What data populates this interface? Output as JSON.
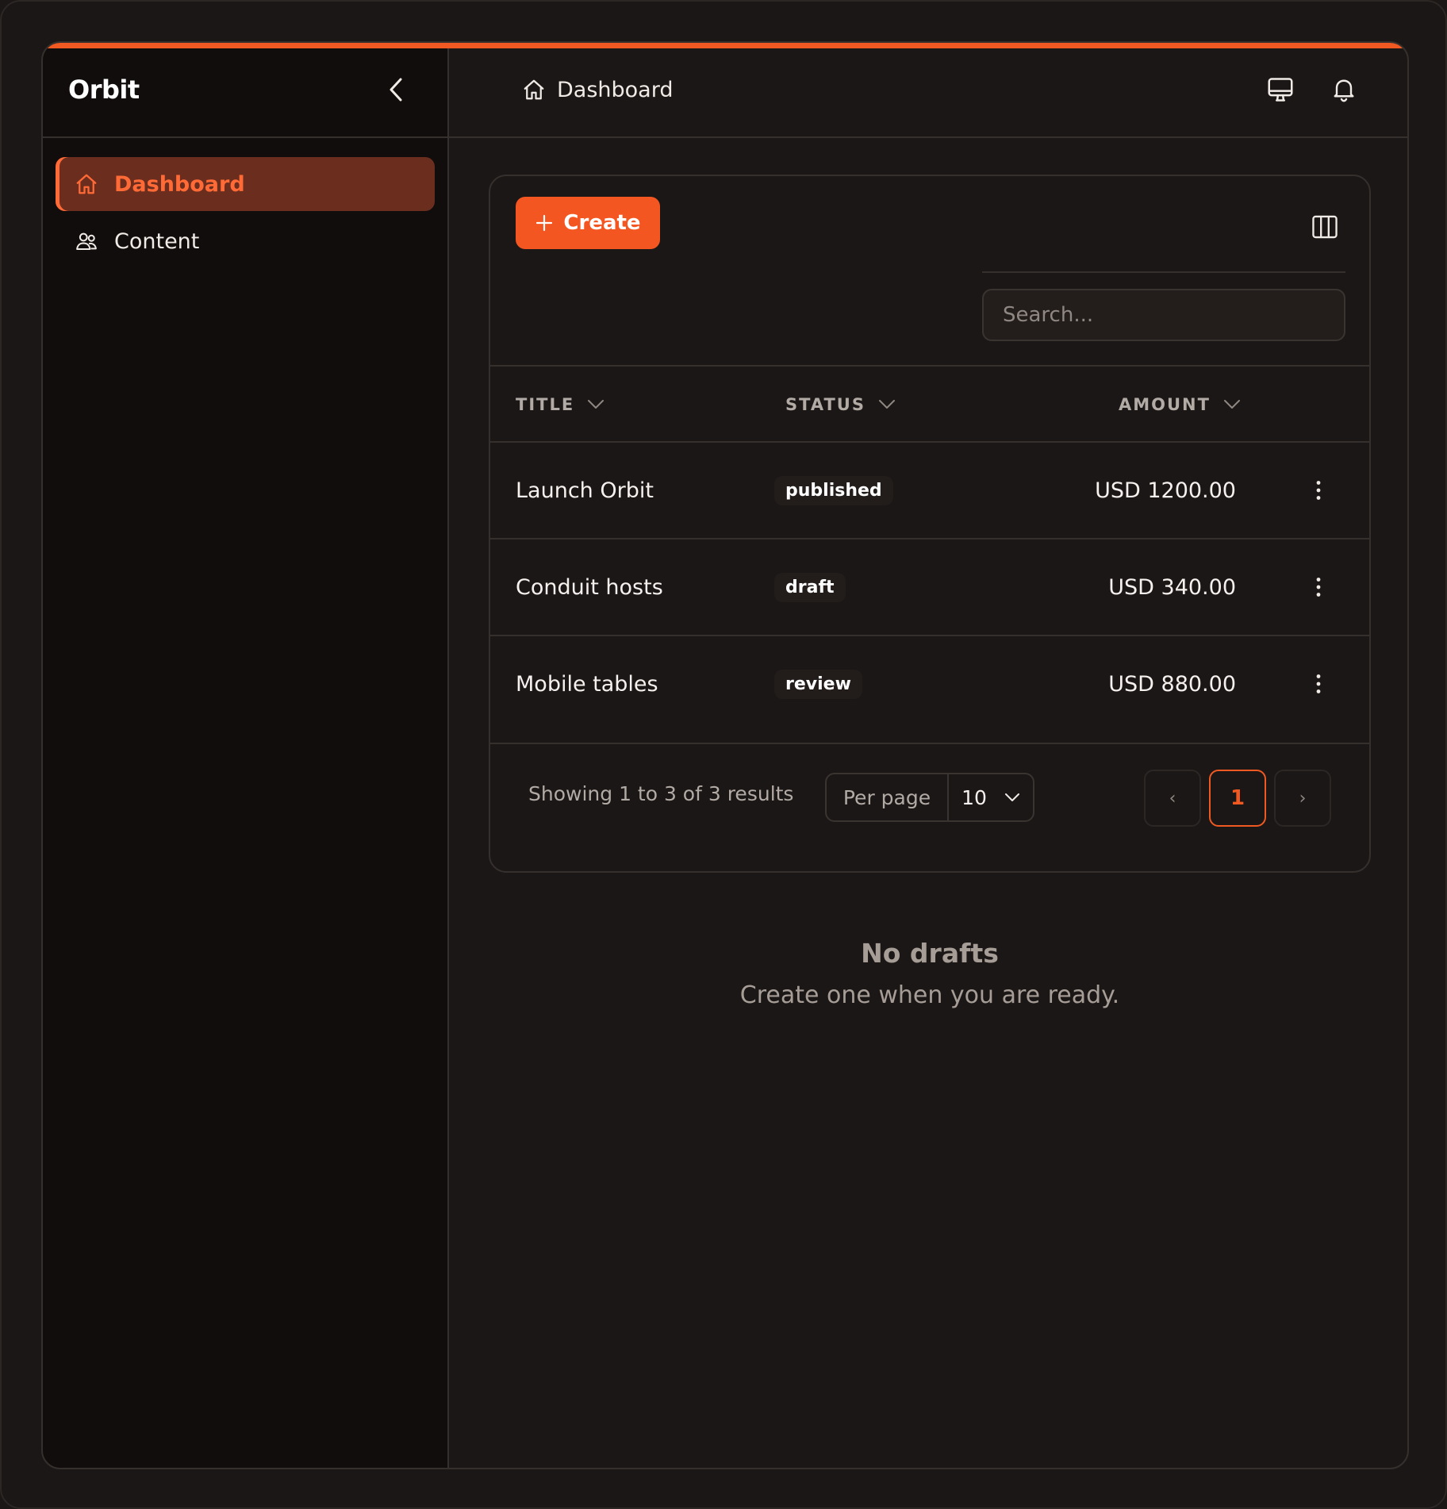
{
  "app": {
    "brand": "Orbit"
  },
  "sidebar": {
    "items": [
      {
        "label": "Dashboard",
        "icon": "home-icon",
        "active": true
      },
      {
        "label": "Content",
        "icon": "users-icon",
        "active": false
      }
    ]
  },
  "header": {
    "breadcrumb": "Dashboard"
  },
  "toolbar": {
    "create_label": "Create",
    "search_placeholder": "Search..."
  },
  "table": {
    "columns": [
      "TITLE",
      "STATUS",
      "AMOUNT"
    ],
    "rows": [
      {
        "title": "Launch Orbit",
        "status": "published",
        "amount": "USD 1200.00"
      },
      {
        "title": "Conduit hosts",
        "status": "draft",
        "amount": "USD 340.00"
      },
      {
        "title": "Mobile tables",
        "status": "review",
        "amount": "USD 880.00"
      }
    ]
  },
  "footer": {
    "showing": "Showing 1 to 3 of 3 results",
    "per_page_label": "Per page",
    "per_page_value": "10",
    "prev": "‹",
    "current_page": "1",
    "next": "›"
  },
  "empty": {
    "title": "No drafts",
    "subtitle": "Create one when you are ready."
  },
  "colors": {
    "accent": "#f05a22",
    "active_bg": "#6b2e1e",
    "background": "#1b1716",
    "sidebar_bg": "#110d0c"
  }
}
